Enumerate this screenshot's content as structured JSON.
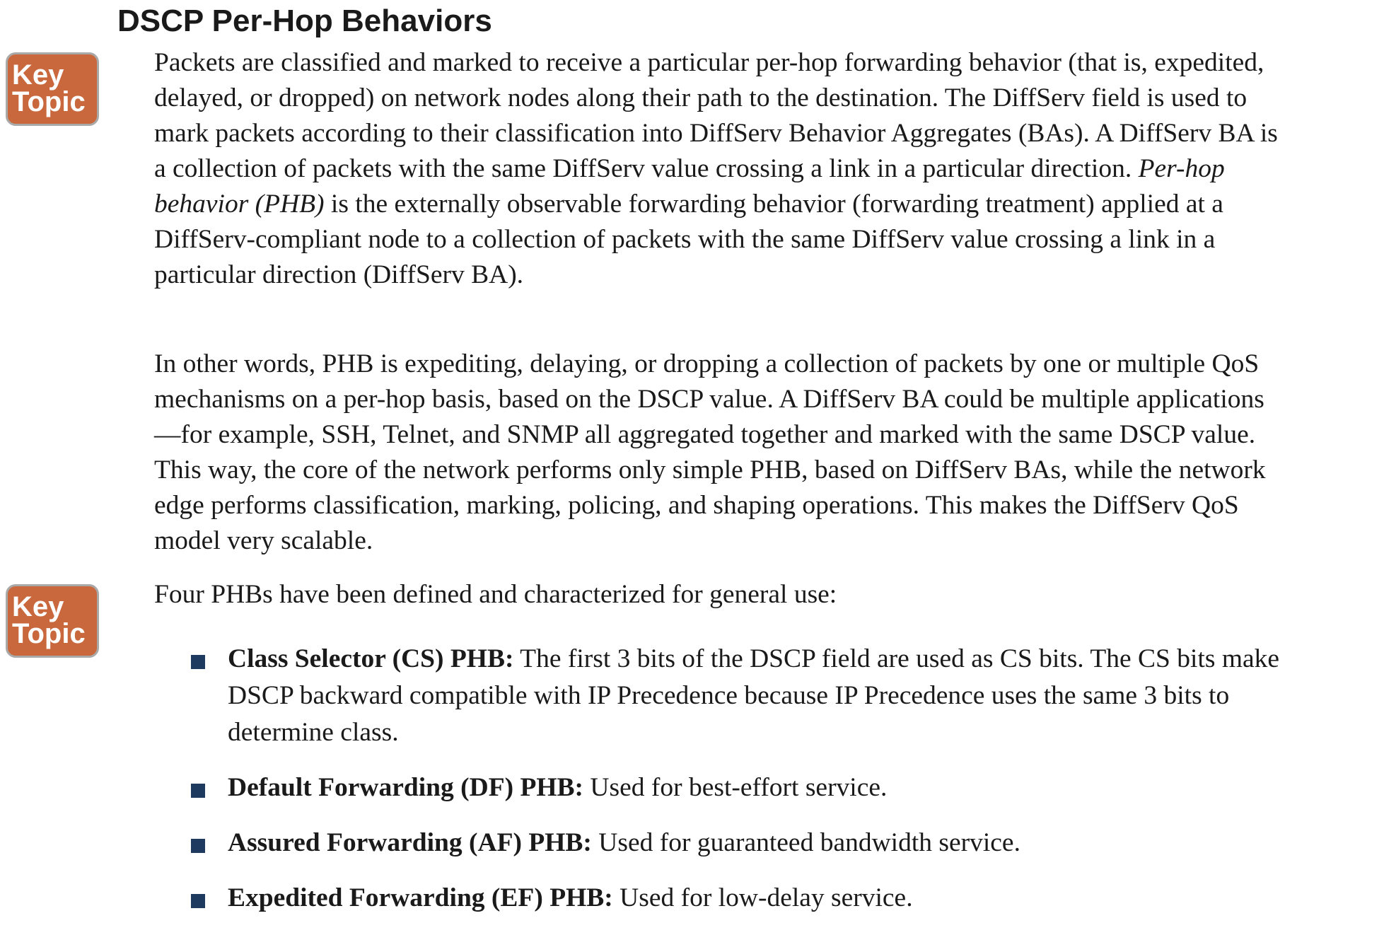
{
  "heading": "DSCP Per-Hop Behaviors",
  "key_topic_badges": [
    {
      "line1": "Key",
      "line2": "Topic"
    },
    {
      "line1": "Key",
      "line2": "Topic"
    }
  ],
  "paragraph1": {
    "before_italic": "Packets are classified and marked to receive a particular per-hop forwarding behavior (that is, expedited, delayed, or dropped) on network nodes along their path to the destination. The DiffServ field is used to mark packets according to their classification into DiffServ Behavior Aggregates (BAs). A DiffServ BA is a collection of packets with the same DiffServ value crossing a link in a particular direction. ",
    "italic": "Per-hop behavior (PHB)",
    "after_italic": " is the externally observable forwarding behavior (forwarding treatment) applied at a DiffServ-compliant node to a collection of packets with the same DiffServ value crossing a link in a particular direction (DiffServ BA)."
  },
  "paragraph2": "In other words, PHB is expediting, delaying, or dropping a collection of packets by one or multiple QoS mechanisms on a per-hop basis, based on the DSCP value. A DiffServ BA could be multiple applications—for example, SSH, Telnet, and SNMP all aggregated together and marked with the same DSCP value. This way, the core of the network performs only simple PHB, based on DiffServ BAs, while the network edge performs classification, marking, policing, and shaping operations. This makes the DiffServ QoS model very scalable.",
  "paragraph3": "Four PHBs have been defined and characterized for general use:",
  "bullets": [
    {
      "term": "Class Selector (CS) PHB:",
      "text": " The first 3 bits of the DSCP field are used as CS bits. The CS bits make DSCP backward compatible with IP Precedence because IP Precedence uses the same 3 bits to determine class."
    },
    {
      "term": "Default Forwarding (DF) PHB:",
      "text": " Used for best-effort service."
    },
    {
      "term": "Assured Forwarding (AF) PHB:",
      "text": " Used for guaranteed bandwidth service."
    },
    {
      "term": "Expedited Forwarding (EF) PHB:",
      "text": " Used for low-delay service."
    }
  ],
  "colors": {
    "badge_fill": "#c9683d",
    "badge_border": "#a9a9a9",
    "bullet_square": "#1f3a5f",
    "text": "#1a1a1a"
  }
}
